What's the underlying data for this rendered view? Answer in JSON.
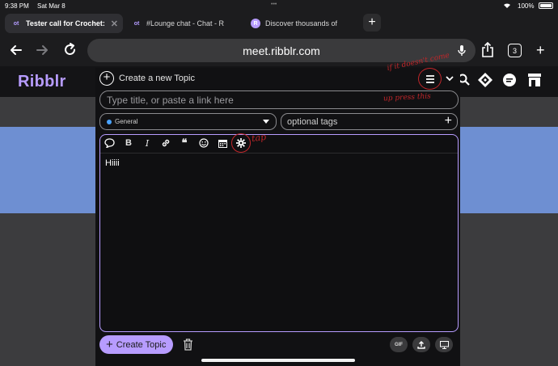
{
  "status": {
    "time": "9:38 PM",
    "date": "Sat Mar 8",
    "battery": "100%",
    "icons": [
      "wifi-icon",
      "battery-icon"
    ]
  },
  "tabs": [
    {
      "label": "Tester call for Crochet:",
      "favicon": "ot",
      "active": true
    },
    {
      "label": "#Lounge chat - Chat - R",
      "favicon": "ot",
      "active": false
    },
    {
      "label": "Discover thousands of",
      "favicon": "R",
      "active": false
    }
  ],
  "address": {
    "url": "meet.ribblr.com",
    "tab_count": "3"
  },
  "site": {
    "logo": "Ribblr"
  },
  "composer": {
    "title": "Create a new Topic",
    "title_placeholder": "Type title, or paste a link here",
    "category": "General",
    "tags_placeholder": "optional tags",
    "body_text": "Hiiii",
    "create_button": "Create Topic",
    "gif_label": "GIF"
  },
  "annotations": {
    "menu_note_line1": "if it doesn't come",
    "menu_note_line2": "up press this",
    "gear_note": "tap"
  },
  "colors": {
    "brand": "#b79cff",
    "annotation": "#c0262a",
    "hero": "#6e8fd2"
  }
}
